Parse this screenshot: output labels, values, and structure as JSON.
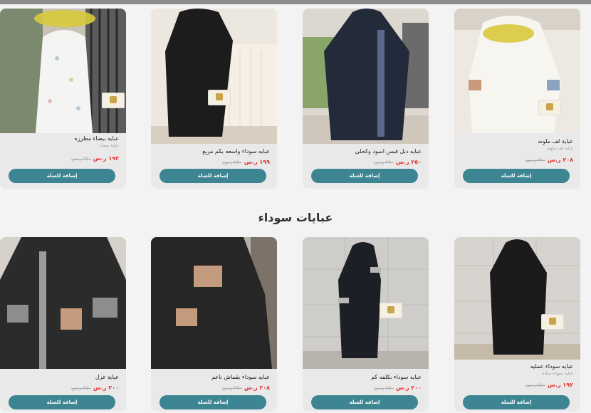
{
  "section": {
    "heading": "عبايات سوداء"
  },
  "cart_button_label": "إضافة للسلة",
  "colors": {
    "accent": "#3d8592",
    "sale_price": "#e0312f",
    "old_price": "#aaaaaa"
  },
  "row1": [
    {
      "title": "عباية لف ملونه",
      "subtitle": "عباية لف ملونه",
      "price_new": "٢٠٨ ر.س",
      "price_old": "٢٩٠ ر.س"
    },
    {
      "title": "عبايه دبل فيس اسود وكحلي",
      "subtitle": "",
      "price_new": "٢٥٠ ر.س",
      "price_old": "٢٩٠ ر.س"
    },
    {
      "title": "عبايه سوداء واسعه بكم مربع",
      "subtitle": "",
      "price_new": "١٩٩ ر.س",
      "price_old": "٢٥٠ ر.س"
    },
    {
      "title": "عبايه بيضاء مطرزه",
      "subtitle": "عباية بيضاء",
      "price_new": "١٩٢ ر.س",
      "price_old": "٢٥٠ ر.س"
    }
  ],
  "row2": [
    {
      "title": "عبايه سوداء عمليه",
      "subtitle": "عباية سوداء سادة",
      "price_new": "١٩٢ ر.س",
      "price_old": "٢٥٠ ر.س"
    },
    {
      "title": "عبايه سوداء بكلفه كم",
      "subtitle": "",
      "price_new": "٢٠٠ ر.س",
      "price_old": "٢٥٠ ر.س"
    },
    {
      "title": "عبايه سوداء بقماش ناعم",
      "subtitle": "",
      "price_new": "٢٠٨ ر.س",
      "price_old": "٢٩٠ ر.س"
    },
    {
      "title": "عباية غزل",
      "subtitle": "",
      "price_new": "٢٠٠ ر.س",
      "price_old": "٢٥٠ ر.س"
    }
  ]
}
